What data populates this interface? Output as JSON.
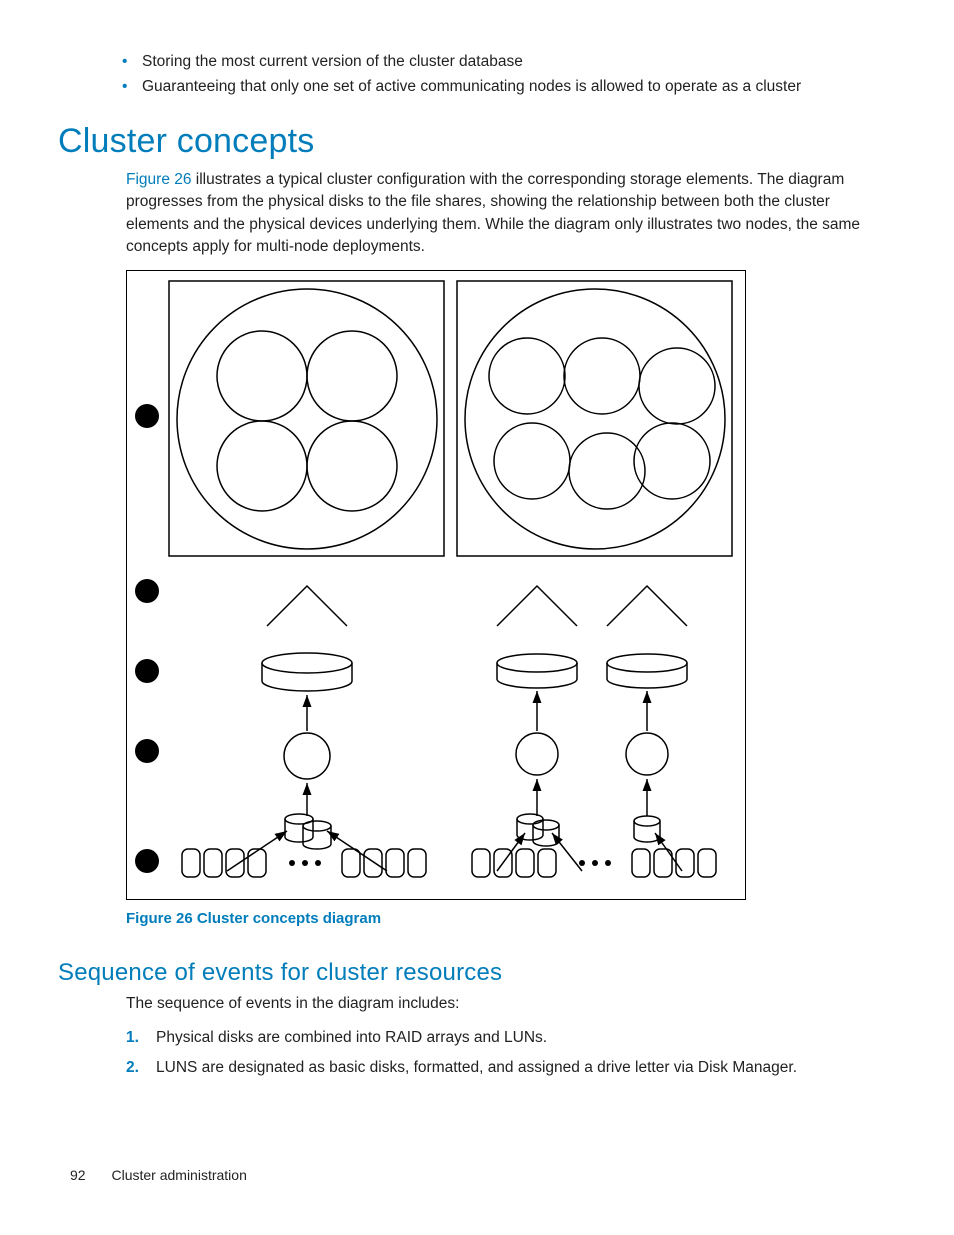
{
  "top_bullets": [
    "Storing the most current version of the cluster database",
    "Guaranteeing that only one set of active communicating nodes is allowed to operate as a cluster"
  ],
  "section_heading": "Cluster concepts",
  "paragraph": {
    "link": "Figure 26",
    "rest": " illustrates a typical cluster configuration with the corresponding storage elements. The diagram progresses from the physical disks to the file shares, showing the relationship between both the cluster elements and the physical devices underlying them. While the diagram only illustrates two nodes, the same concepts apply for multi-node deployments."
  },
  "figure_caption": "Figure 26 Cluster concepts diagram",
  "subsection_heading": "Sequence of events for cluster resources",
  "seq_intro": "The sequence of events in the diagram includes:",
  "seq_items": [
    "Physical disks are combined into RAID arrays and LUNs.",
    "LUNS are designated as basic disks, formatted, and assigned a drive letter via Disk Manager."
  ],
  "footer": {
    "page_number": "92",
    "chapter": "Cluster administration"
  }
}
